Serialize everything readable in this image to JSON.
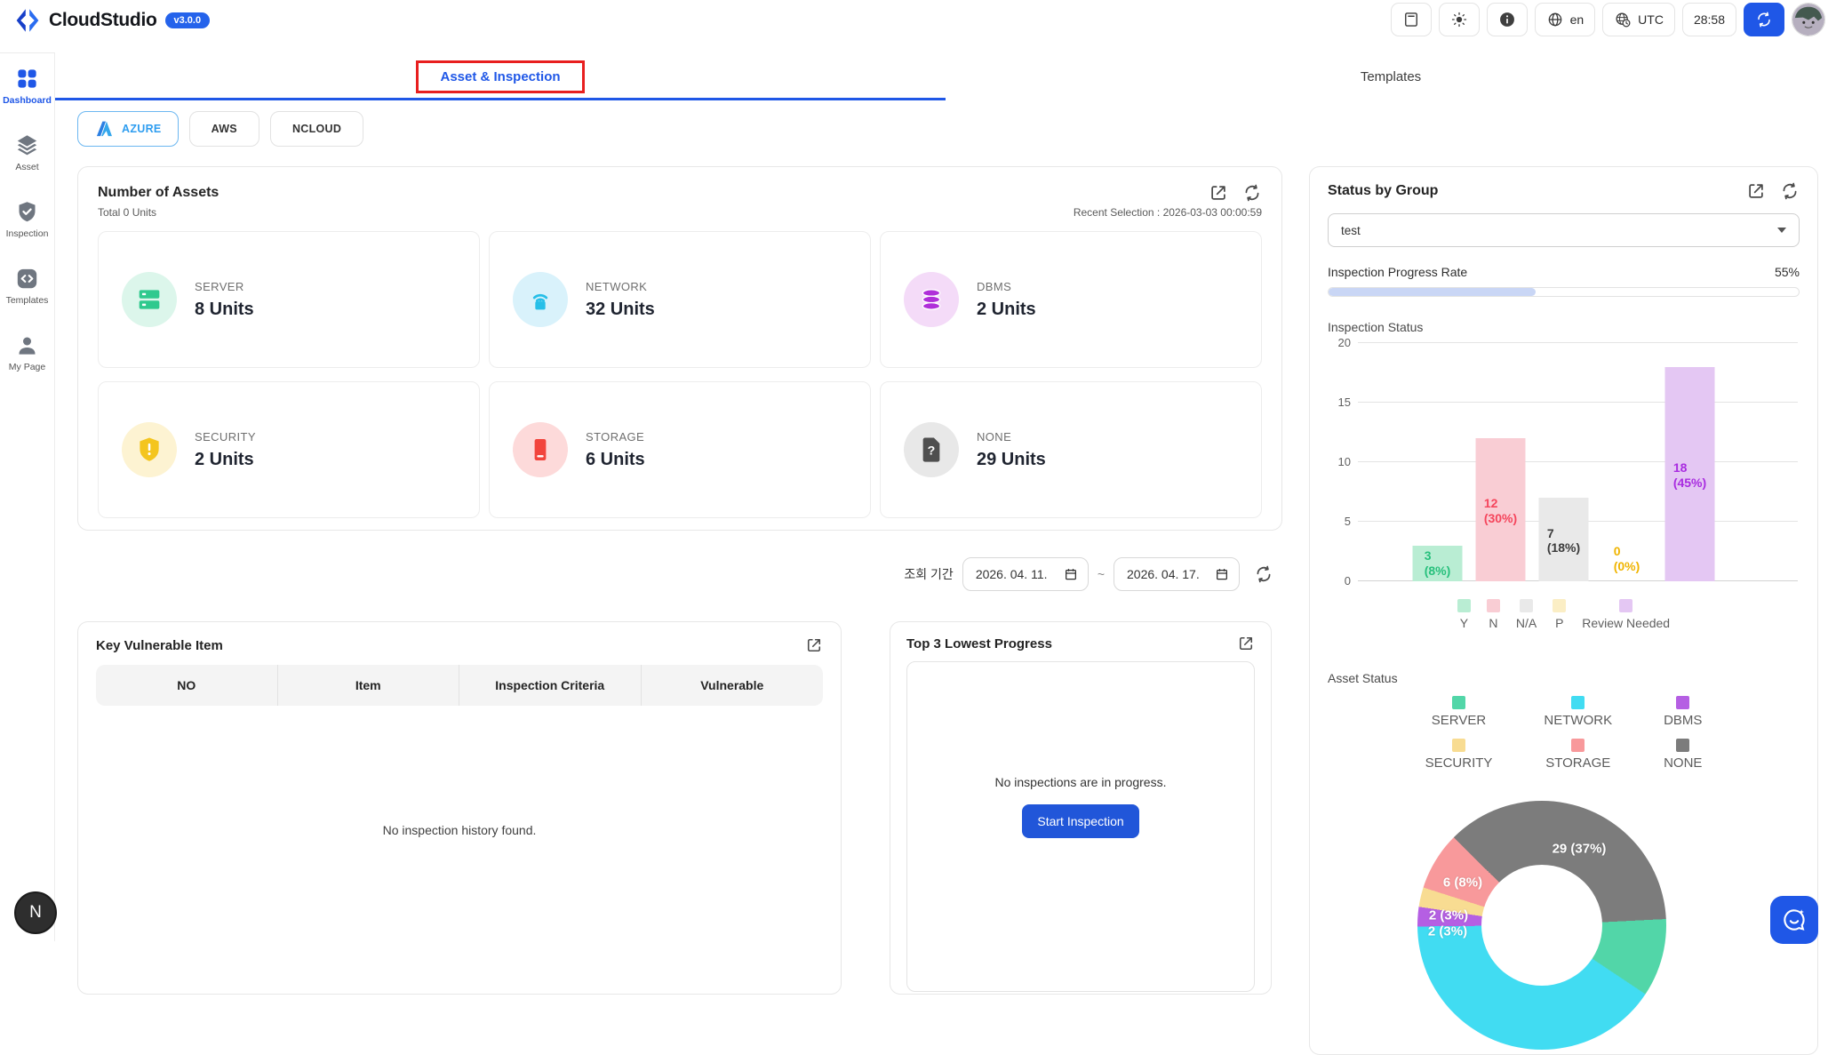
{
  "header": {
    "brand": "CloudStudio",
    "version": "v3.0.0",
    "language": "en",
    "timezone": "UTC",
    "timer": "28:58"
  },
  "sidebar": {
    "items": [
      {
        "label": "Dashboard",
        "icon": "grid-icon",
        "active": true
      },
      {
        "label": "Asset",
        "icon": "layers-icon",
        "active": false
      },
      {
        "label": "Inspection",
        "icon": "shield-check-icon",
        "active": false
      },
      {
        "label": "Templates",
        "icon": "code-box-icon",
        "active": false
      },
      {
        "label": "My Page",
        "icon": "person-icon",
        "active": false
      }
    ]
  },
  "tabs": [
    {
      "label": "Asset & Inspection",
      "active": true,
      "highlight_box": true
    },
    {
      "label": "Templates",
      "active": false
    }
  ],
  "providers": [
    {
      "label": "AZURE",
      "active": true,
      "icon": "azure-icon"
    },
    {
      "label": "AWS",
      "active": false
    },
    {
      "label": "NCLOUD",
      "active": false
    }
  ],
  "assets_card": {
    "title": "Number of Assets",
    "total": "Total 0 Units",
    "recent_selection": "Recent Selection : 2026-03-03 00:00:59",
    "items": [
      {
        "label": "SERVER",
        "value": "8 Units",
        "icon": "server-icon",
        "color": "#2fc98e",
        "bg": "#dcf6eb"
      },
      {
        "label": "NETWORK",
        "value": "32 Units",
        "icon": "network-icon",
        "color": "#27bfe8",
        "bg": "#d9f2fb"
      },
      {
        "label": "DBMS",
        "value": "2 Units",
        "icon": "dbms-icon",
        "color": "#b02fd9",
        "bg": "#f4dbf8"
      },
      {
        "label": "SECURITY",
        "value": "2 Units",
        "icon": "security-icon",
        "color": "#f4c51e",
        "bg": "#fdf3d2"
      },
      {
        "label": "STORAGE",
        "value": "6 Units",
        "icon": "storage-icon",
        "color": "#f2453d",
        "bg": "#fddada"
      },
      {
        "label": "NONE",
        "value": "29 Units",
        "icon": "none-icon",
        "color": "#4f4f4f",
        "bg": "#e8e8e8"
      }
    ]
  },
  "date_filter": {
    "label": "조회 기간",
    "start": "2026. 04. 11.",
    "separator": "~",
    "end": "2026. 04. 17."
  },
  "vulnerable_card": {
    "title": "Key Vulnerable Item",
    "columns": [
      "NO",
      "Item",
      "Inspection Criteria",
      "Vulnerable"
    ],
    "empty": "No inspection history found."
  },
  "progress_card": {
    "title": "Top 3 Lowest Progress",
    "empty": "No inspections are in progress.",
    "button": "Start Inspection"
  },
  "status_card": {
    "title": "Status by Group",
    "group": "test",
    "progress_label": "Inspection Progress Rate",
    "progress_value": "55%",
    "progress_fill_percent": 44,
    "inspection_section": "Inspection Status",
    "asset_section": "Asset Status"
  },
  "colors": {
    "accent": "#1f57e7",
    "highlight_red": "#e81f1f"
  },
  "chart_data": [
    {
      "type": "bar",
      "title": "Inspection Status",
      "categories": [
        "Y",
        "N",
        "N/A",
        "P",
        "Review Needed"
      ],
      "values": [
        3,
        12,
        7,
        0,
        18
      ],
      "percent_labels": [
        "8%",
        "30%",
        "18%",
        "0%",
        "45%"
      ],
      "bar_colors": [
        "#b9edd3",
        "#f9cdd4",
        "#e9e9e9",
        "#fbeec5",
        "#e4c7f3"
      ],
      "label_colors": [
        "#27c07c",
        "#f5455c",
        "#3c3c3c",
        "#f0b400",
        "#a92ce0"
      ],
      "ylim": [
        0,
        20
      ],
      "yticks": [
        0,
        5,
        10,
        15,
        20
      ],
      "grid": true,
      "legend_position": "bottom"
    },
    {
      "type": "pie",
      "title": "Asset Status",
      "donut": true,
      "legend": [
        {
          "label": "SERVER",
          "color": "#52d6a8"
        },
        {
          "label": "NETWORK",
          "color": "#41dcf2"
        },
        {
          "label": "DBMS",
          "color": "#b55fe3"
        },
        {
          "label": "SECURITY",
          "color": "#f8dc92"
        },
        {
          "label": "STORAGE",
          "color": "#f8999b"
        },
        {
          "label": "NONE",
          "color": "#7c7c7c"
        }
      ],
      "slices": [
        {
          "label": "NONE",
          "value": 29,
          "color": "#7c7c7c",
          "display": "29 (37%)"
        },
        {
          "label": "SERVER",
          "value": 8,
          "color": "#52d6a8",
          "display": ""
        },
        {
          "label": "NETWORK",
          "value": 32,
          "color": "#41dcf2",
          "display": ""
        },
        {
          "label": "DBMS",
          "value": 2,
          "color": "#b55fe3",
          "display": "2 (3%)"
        },
        {
          "label": "SECURITY",
          "value": 2,
          "color": "#f8dc92",
          "display": "2 (3%)"
        },
        {
          "label": "STORAGE",
          "value": 6,
          "color": "#f8999b",
          "display": "6 (8%)"
        }
      ]
    }
  ],
  "fab": {
    "n_label": "N"
  }
}
